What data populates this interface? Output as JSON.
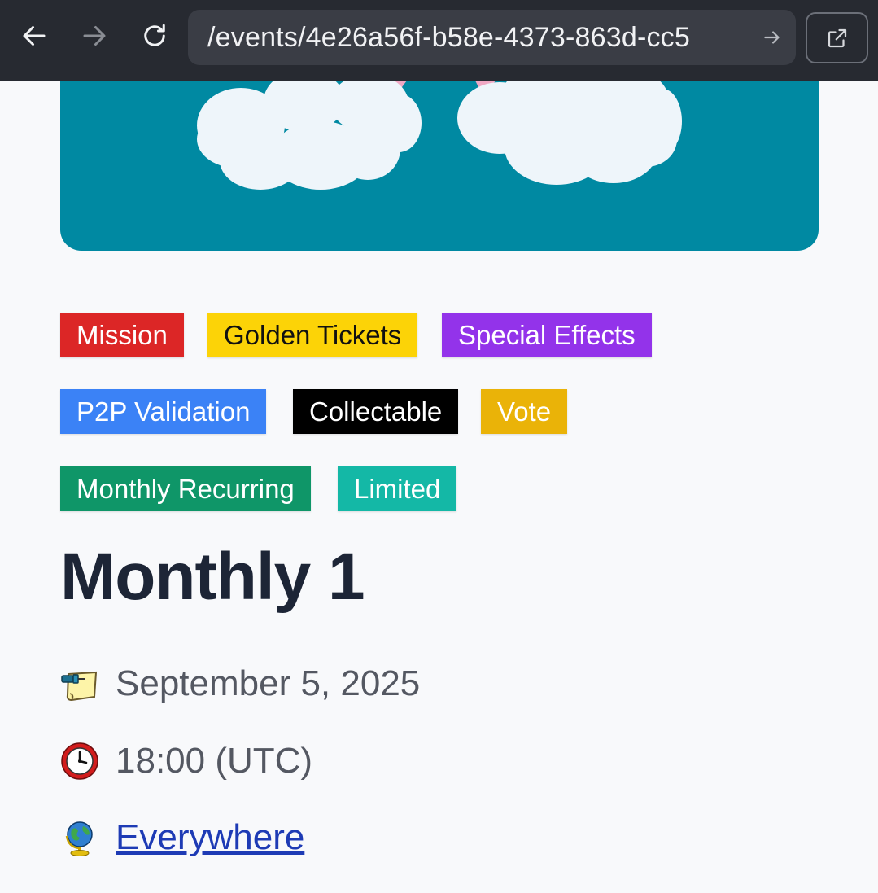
{
  "browser": {
    "url": "/events/4e26a56f-b58e-4373-863d-cc5",
    "back_icon": "arrow-left-icon",
    "forward_icon": "arrow-right-icon",
    "reload_icon": "reload-icon",
    "open_external_icon": "open-external-icon"
  },
  "event": {
    "tags": [
      {
        "label": "Mission",
        "bg": "#dc2626",
        "fg": "#ffffff"
      },
      {
        "label": "Golden Tickets",
        "bg": "#fcd307",
        "fg": "#111111"
      },
      {
        "label": "Special Effects",
        "bg": "#9333ea",
        "fg": "#ffffff"
      },
      {
        "label": "P2P Validation",
        "bg": "#3b82f6",
        "fg": "#ffffff"
      },
      {
        "label": "Collectable",
        "bg": "#000000",
        "fg": "#ffffff"
      },
      {
        "label": "Vote",
        "bg": "#eab308",
        "fg": "#ffffff"
      },
      {
        "label": "Monthly Recurring",
        "bg": "#0f9668",
        "fg": "#ffffff"
      },
      {
        "label": "Limited",
        "bg": "#14b8a6",
        "fg": "#ffffff"
      }
    ],
    "title": "Monthly 1",
    "date": "September 5, 2025",
    "date_icon": "pushpin-note-icon",
    "time": "18:00 (UTC)",
    "time_icon": "clock-icon",
    "location": "Everywhere",
    "location_icon": "globe-icon"
  },
  "colors": {
    "hero_bg": "#0089a2",
    "cloud": "#eef5fa",
    "title": "#1d2536",
    "link": "#1e3bb5"
  }
}
